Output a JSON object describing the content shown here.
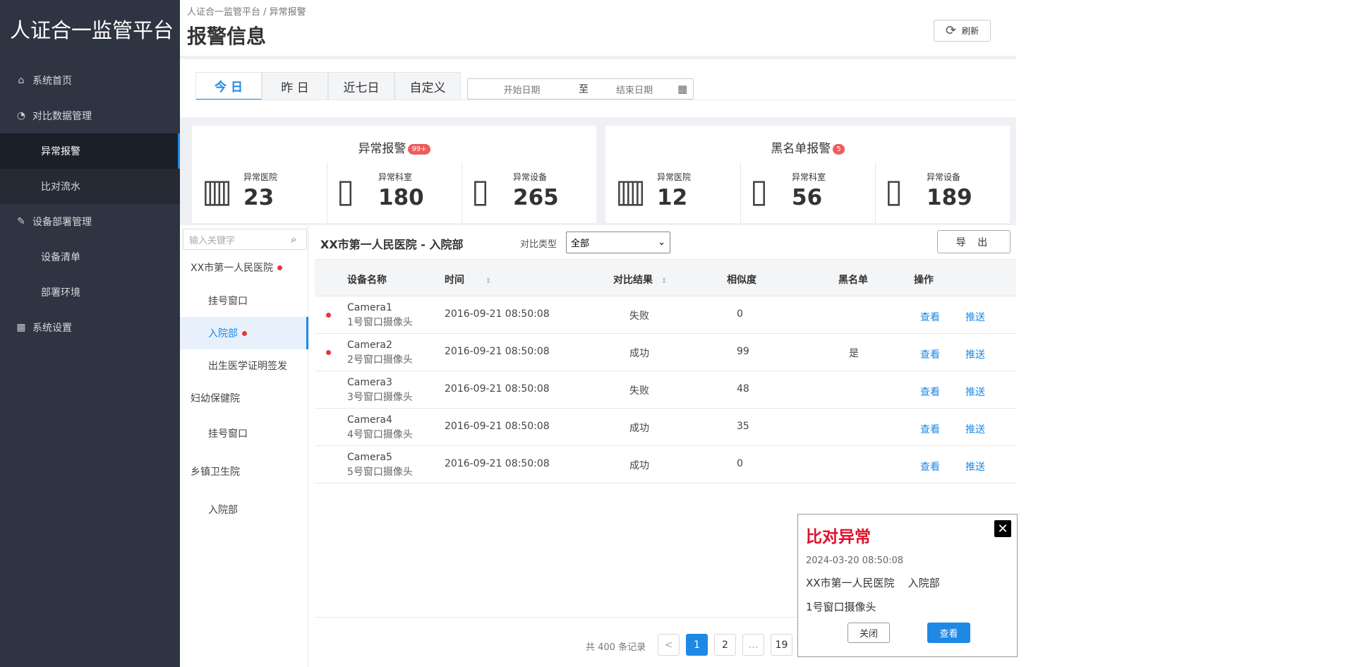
{
  "app": {
    "brand": "人证合一监管平台"
  },
  "sidebar": {
    "items": [
      {
        "label": "系统首页",
        "icon": "home-icon"
      },
      {
        "label": "对比数据管理",
        "icon": "gauge-icon"
      },
      {
        "label": "异常报警"
      },
      {
        "label": "比对流水"
      },
      {
        "label": "设备部署管理",
        "icon": "edit-icon"
      },
      {
        "label": "设备清单"
      },
      {
        "label": "部署环境"
      },
      {
        "label": "系统设置",
        "icon": "table-icon"
      }
    ]
  },
  "header": {
    "breadcrumb": "人证合一监管平台 / 异常报警",
    "title": "报警信息",
    "refresh_label": "刷新"
  },
  "date_tabs": [
    "今 日",
    "昨 日",
    "近七日",
    "自定义"
  ],
  "date_range": {
    "start_placeholder": "开始日期",
    "separator": "至",
    "end_placeholder": "结束日期"
  },
  "stats": {
    "abnormal": {
      "title": "异常报警",
      "badge": "99+",
      "items": [
        {
          "label": "异常医院",
          "value": "23"
        },
        {
          "label": "异常科室",
          "value": "180"
        },
        {
          "label": "异常设备",
          "value": "265"
        }
      ]
    },
    "blacklist": {
      "title": "黑名单报警",
      "badge": "5",
      "items": [
        {
          "label": "异常医院",
          "value": "12"
        },
        {
          "label": "异常科室",
          "value": "56"
        },
        {
          "label": "异常设备",
          "value": "189"
        }
      ]
    }
  },
  "tree": {
    "search_placeholder": "输入关键字",
    "nodes": [
      {
        "label": "XX市第一人民医院",
        "level": 1,
        "alert": true
      },
      {
        "label": "挂号窗口",
        "level": 2,
        "alert": false
      },
      {
        "label": "入院部",
        "level": 2,
        "alert": true,
        "selected": true
      },
      {
        "label": "出生医学证明签发",
        "level": 2,
        "alert": false
      },
      {
        "label": "妇幼保健院",
        "level": 1,
        "alert": false
      },
      {
        "label": "挂号窗口",
        "level": 2,
        "alert": false
      },
      {
        "label": "乡镇卫生院",
        "level": 1,
        "alert": false
      },
      {
        "label": "入院部",
        "level": 2,
        "alert": false
      }
    ]
  },
  "table": {
    "title": "XX市第一人民医院 - 入院部",
    "filter_label": "对比类型",
    "filter_value": "全部",
    "export_label": "导 出",
    "columns": [
      "设备名称",
      "时间",
      "对比结果",
      "相似度",
      "黑名单",
      "操作"
    ],
    "rows": [
      {
        "alert": true,
        "name": "Camera1",
        "sub": "1号窗口摄像头",
        "time": "2016-09-21  08:50:08",
        "result": "失败",
        "similarity": "0",
        "blacklist": "",
        "view": "查看",
        "push": "推送"
      },
      {
        "alert": true,
        "name": "Camera2",
        "sub": "2号窗口摄像头",
        "time": "2016-09-21  08:50:08",
        "result": "成功",
        "similarity": "99",
        "blacklist": "是",
        "view": "查看",
        "push": "推送"
      },
      {
        "alert": false,
        "name": "Camera3",
        "sub": "3号窗口摄像头",
        "time": "2016-09-21  08:50:08",
        "result": "失败",
        "similarity": "48",
        "blacklist": "",
        "view": "查看",
        "push": "推送"
      },
      {
        "alert": false,
        "name": "Camera4",
        "sub": "4号窗口摄像头",
        "time": "2016-09-21  08:50:08",
        "result": "成功",
        "similarity": "35",
        "blacklist": "",
        "view": "查看",
        "push": "推送"
      },
      {
        "alert": false,
        "name": "Camera5",
        "sub": "5号窗口摄像头",
        "time": "2016-09-21  08:50:08",
        "result": "成功",
        "similarity": "0",
        "blacklist": "",
        "view": "查看",
        "push": "推送"
      }
    ]
  },
  "pagination": {
    "total": "共 400 条记录",
    "prev": "<",
    "pages": [
      "1",
      "2",
      "...",
      "19"
    ],
    "current": "1"
  },
  "popup": {
    "title": "比对异常",
    "time": "2024-03-20  08:50:08",
    "location": "XX市第一人民医院    入院部",
    "device": "1号窗口摄像头",
    "close_label": "关闭",
    "view_label": "查看"
  },
  "colors": {
    "accent": "#1e88e5",
    "sidebar_bg": "#2f3442",
    "alert": "#e53935",
    "popup_title": "#e0102a"
  }
}
